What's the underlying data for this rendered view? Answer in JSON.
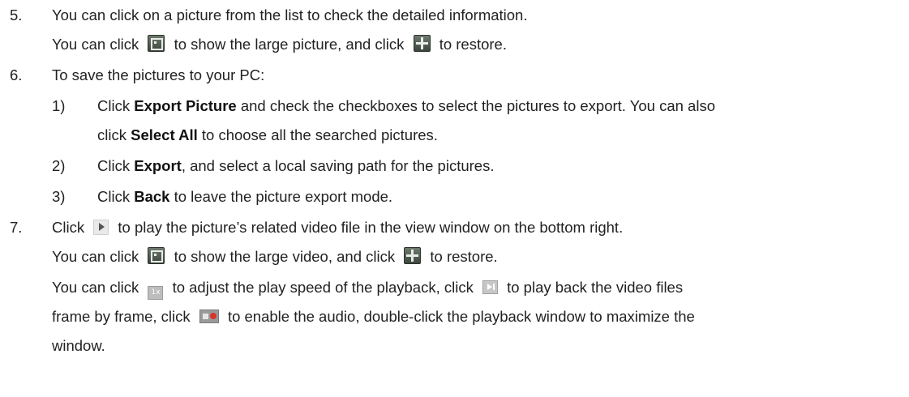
{
  "steps": {
    "s5": {
      "num": "5.",
      "line1": "You can click on a picture from the list to check the detailed information.",
      "line2a": "You can click",
      "line2b": "to show the large picture, and click",
      "line2c": "to restore."
    },
    "s6": {
      "num": "6.",
      "intro": "To save the pictures to your PC:",
      "sub1": {
        "num": "1)",
        "a": "Click",
        "b": "Export Picture",
        "c": "and check the checkboxes to select the pictures to export. You can also",
        "d": "click",
        "e": "Select All",
        "f": "to choose all the searched pictures."
      },
      "sub2": {
        "num": "2)",
        "a": "Click",
        "b": "Export",
        "c": ", and select a local saving path for the pictures."
      },
      "sub3": {
        "num": "3)",
        "a": "Click",
        "b": "Back",
        "c": "to leave the picture export mode."
      }
    },
    "s7": {
      "num": "7.",
      "line1a": "Click",
      "line1b": "to play the picture’s related video file in the view window on the bottom right.",
      "line2a": "You can click",
      "line2b": "to show the large video, and click",
      "line2c": "to restore.",
      "line3a": "You can click",
      "line3b": "to adjust the play speed of the playback, click",
      "line3c": "to play back the video files",
      "line4a": "frame by frame, click",
      "line4b": "to enable the audio, double-click the playback window to maximize the",
      "line5": "window."
    }
  },
  "icons": {
    "speed_label": "1x",
    "fullscreen": "fullscreen-icon",
    "restore": "restore-icon",
    "play": "play-icon",
    "frame": "frame-by-frame-icon",
    "audio": "audio-icon"
  }
}
